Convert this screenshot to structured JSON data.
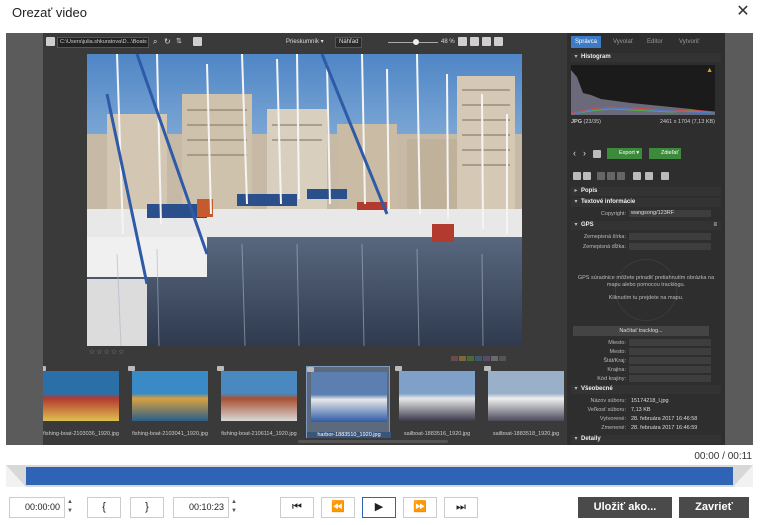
{
  "window": {
    "title": "Orezať video",
    "close_icon": "close-icon"
  },
  "app": {
    "path": "C:\\Users\\julia.shkuratova\\D...\\Boats",
    "browser_label": "Prieskumník",
    "preview_label": "Náhľad",
    "zoom_value": "48 %",
    "zoom_fraction": 0.55
  },
  "rating": "☆☆☆☆☆",
  "color_labels": [
    "#6a4a4a",
    "#7a6a3a",
    "#4a6a3a",
    "#3a5a6a",
    "#5a4a6a",
    "#6a6a6a",
    "#555555"
  ],
  "filmstrip": [
    {
      "caption": "fishing-boat-2103036_1920.jpg",
      "selected": false
    },
    {
      "caption": "fishing-boat-2103041_1920.jpg",
      "selected": false
    },
    {
      "caption": "fishing-boat-2106114_1920.jpg",
      "selected": false
    },
    {
      "caption": "harbor-1883510_1920.jpg",
      "selected": true
    },
    {
      "caption": "sailboat-1883516_1920.jpg",
      "selected": false
    },
    {
      "caption": "sailboat-1883518_1920.jpg",
      "selected": false
    }
  ],
  "right_panel": {
    "tabs": [
      "Správca",
      "Vyvolať",
      "Editor",
      "Vytvoriť"
    ],
    "active_tab": 0,
    "histogram_label": "Histogram",
    "file_type": "JPG",
    "file_index": "(23/35)",
    "dimensions": "2461 x 1704 (7,13 KB)",
    "export_label": "Export",
    "share_label": "Zdieľať",
    "sections": {
      "popis": "Popis",
      "textove": "Textové informácie",
      "gps": "GPS",
      "vseobecne": "Všeobecné",
      "detaily": "Detaily"
    },
    "copyright_label": "Copyright:",
    "copyright_value": "wangsong/123RF",
    "lat_label": "Zemepisná šírka:",
    "lon_label": "Zemepisná dĺžka:",
    "gps_note_1": "GPS súradnice môžete priradiť pretiahnutím obrázka na mapu alebo pomocou tracklogu.",
    "gps_note_2": "Kliknutím tu prejdete na mapu.",
    "gps_button": "Načítať tracklog...",
    "location_fields": [
      "Miesto:",
      "Mesto:",
      "Štát/Kraj:",
      "Krajina:",
      "Kód krajiny:"
    ],
    "general": [
      {
        "label": "Názov súboru:",
        "value": "15174218_l.jpg"
      },
      {
        "label": "Veľkosť súboru:",
        "value": "7,13 KB"
      },
      {
        "label": "Vytvorené:",
        "value": "28. februára 2017 16:46:58"
      },
      {
        "label": "Zmenené:",
        "value": "28. februára 2017 16:46:59"
      }
    ]
  },
  "video": {
    "position_readout": "00:00 / 00:11",
    "trim_start_fraction": 0.0,
    "trim_end_fraction": 1.0,
    "start_time": "00:00:00",
    "end_time": "00:10:23",
    "mark_in": "{",
    "mark_out": "}",
    "save_label": "Uložiť ako...",
    "close_label": "Zavrieť"
  }
}
